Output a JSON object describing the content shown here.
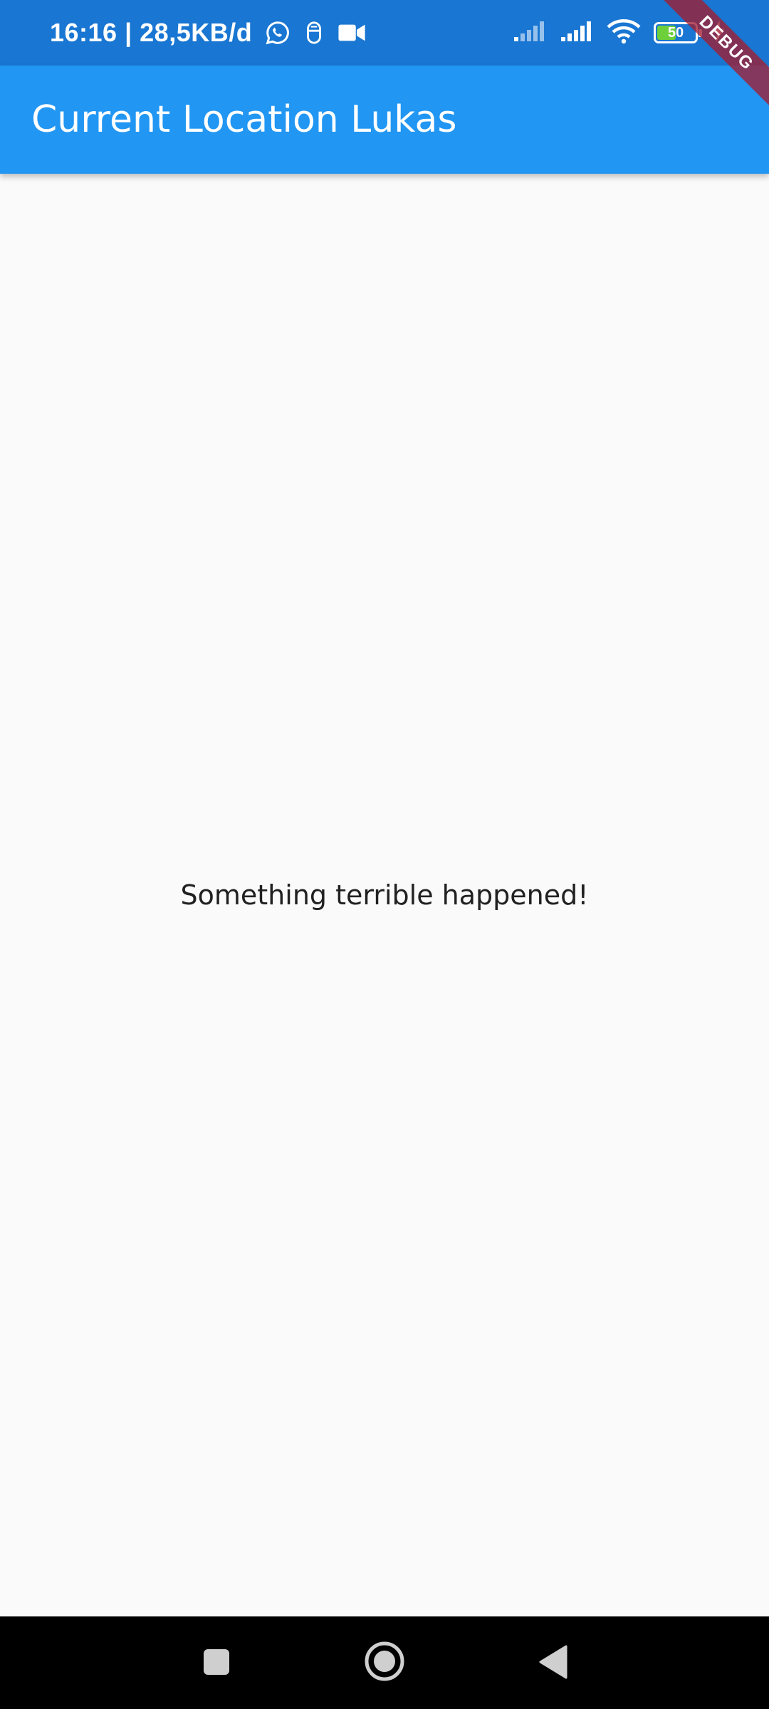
{
  "status_bar": {
    "time_speed": "16:16 | 28,5KB/d",
    "battery_level": "50",
    "battery_fraction": 0.5,
    "icons": [
      "whatsapp-icon",
      "notification-app-icon",
      "video-camera-icon",
      "signal-weak-icon",
      "signal-icon",
      "wifi-icon",
      "battery-icon",
      "charging-icon"
    ]
  },
  "app_bar": {
    "title": "Current Location Lukas",
    "color": "#2196f3"
  },
  "debug_banner": {
    "label": "DEBUG"
  },
  "body": {
    "message": "Something terrible happened!"
  },
  "nav_bar": {
    "buttons": [
      "recents-button",
      "home-button",
      "back-button"
    ]
  }
}
